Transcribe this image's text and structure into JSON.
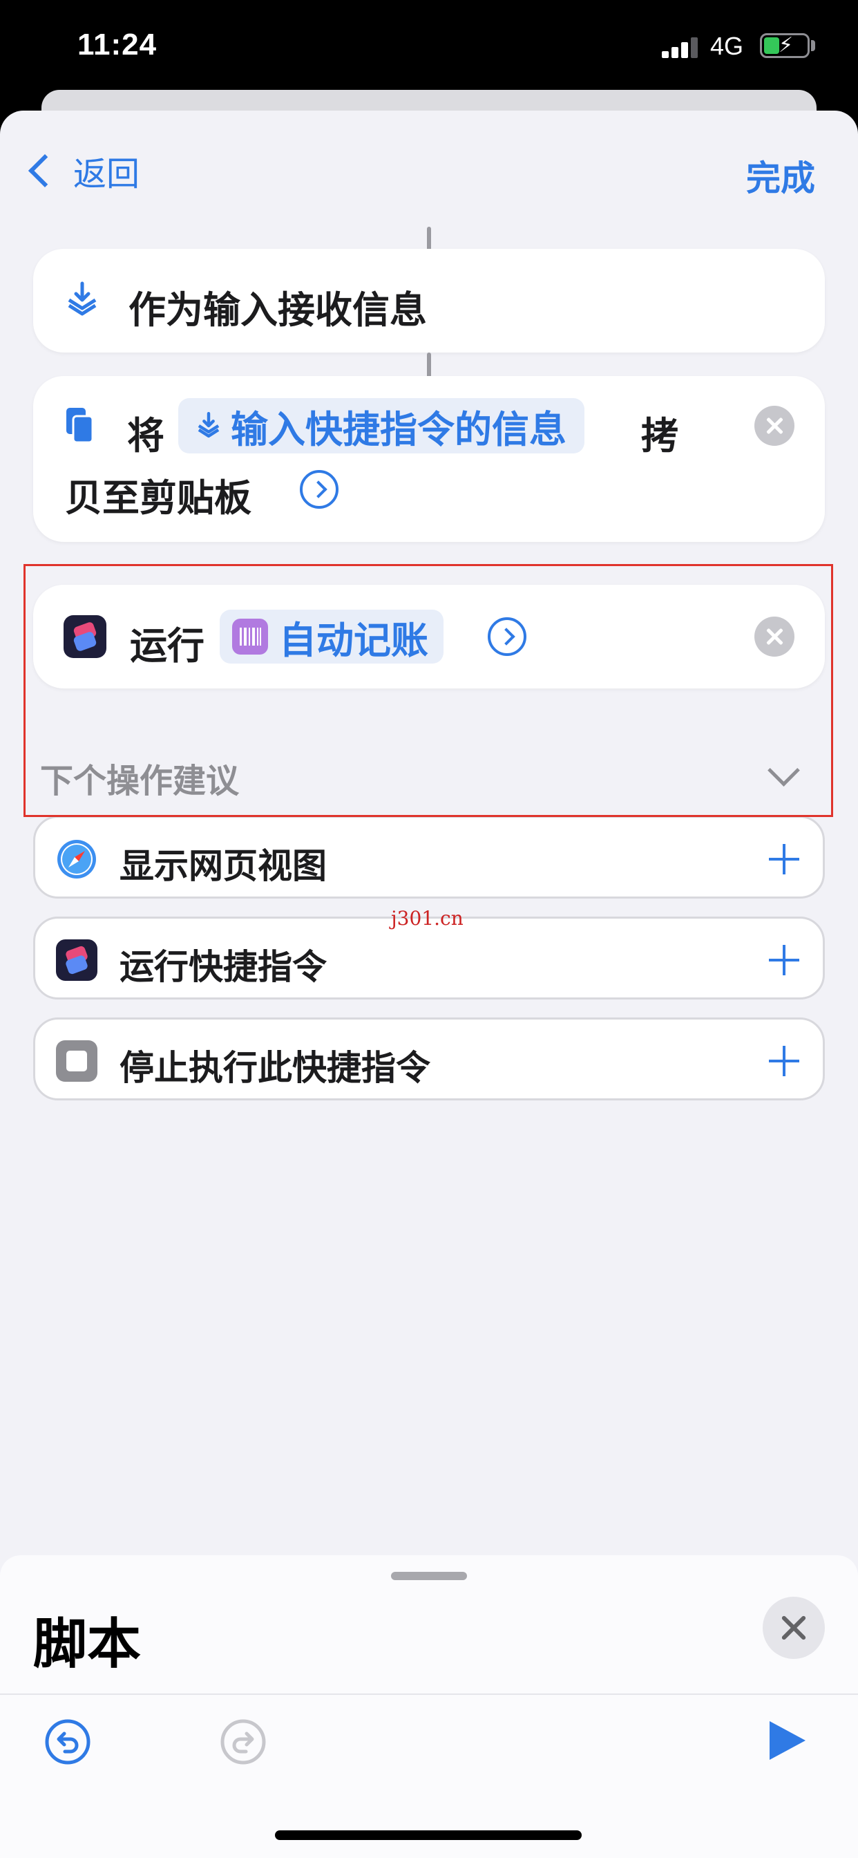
{
  "status_bar": {
    "time": "11:24",
    "network": "4G",
    "battery_charging": true
  },
  "nav": {
    "back_label": "返回",
    "done_label": "完成"
  },
  "actions": [
    {
      "text": "作为输入接收信息",
      "icon": "receive-input-icon"
    },
    {
      "prefix": "将",
      "variable": "输入快捷指令的信息",
      "suffix_line1": "拷",
      "line2": "贝至剪贴板",
      "icon": "clipboard-icon"
    },
    {
      "prefix": "运行",
      "shortcut": "自动记账",
      "icon": "shortcuts-app-icon",
      "shortcut_icon": "barcode-icon"
    }
  ],
  "suggestions": {
    "title": "下个操作建议",
    "items": [
      {
        "label": "显示网页视图",
        "icon": "safari-icon"
      },
      {
        "label": "运行快捷指令",
        "icon": "shortcuts-app-icon"
      },
      {
        "label": "停止执行此快捷指令",
        "icon": "stop-icon"
      }
    ]
  },
  "watermark": "j301.cn",
  "bottom_panel": {
    "title": "脚本"
  },
  "colors": {
    "accent": "#2f7ae5",
    "highlight": "#e0342c",
    "background": "#f2f2f7"
  }
}
